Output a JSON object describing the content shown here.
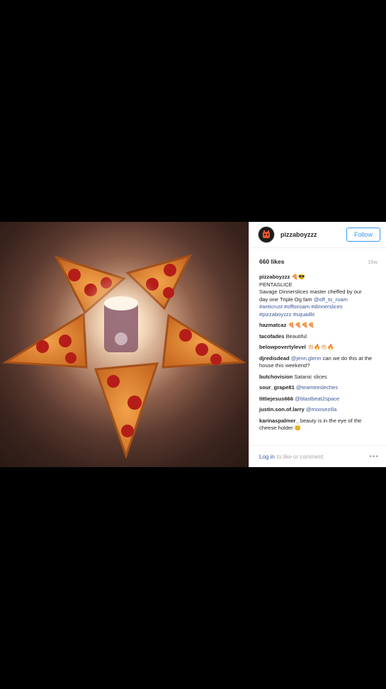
{
  "post": {
    "username": "pizzaboyzzz",
    "follow_label": "Follow",
    "likes": "660 likes",
    "time": "15w",
    "caption": {
      "user": "pizzaboyzzz",
      "user_emoji": "🍕😎",
      "line1": "PENTASLICE",
      "line2": "Savage Dinnerslices master cheffed by our",
      "line3_text": "day one Triple Og fam ",
      "line3_mention": "@off_to_roam",
      "line4": "#anticrust #offtoroam #dinnerslices",
      "line5": "#pizzaboyzzz #squadlit"
    },
    "comments": [
      {
        "user": "hazmatcaz",
        "text": " 🍕🍕🍕🍕",
        "mention": ""
      },
      {
        "user": "tacofades",
        "text": " Beautiful",
        "mention": ""
      },
      {
        "user": "belowpovertylevel",
        "text": " 👏🏻🔥👏🏻🔥",
        "mention": ""
      },
      {
        "user": "djredisdead",
        "text": "",
        "mention": " @jenn.glenn",
        "text2": " can we do this at the house this weekend?"
      },
      {
        "user": "butchovision",
        "text": " Satanic slices",
        "mention": ""
      },
      {
        "user": "sour_grape81",
        "text": "",
        "mention": " @teamtresleches"
      },
      {
        "user": "tittiejesus666",
        "text": "",
        "mention": " @blastbeat2space"
      },
      {
        "user": "justin.son.of.larry",
        "text": "",
        "mention": " @moosezilla"
      },
      {
        "user": "karinaspalmer_",
        "text": " beauty is in the eye of the cheese holder 😊",
        "mention": ""
      }
    ],
    "footer": {
      "login": "Log in",
      "rest": "to like or comment.",
      "more": "•••"
    }
  },
  "colors": {
    "link": "#3b5998",
    "follow": "#3897f0",
    "muted": "#a8a8a8"
  }
}
